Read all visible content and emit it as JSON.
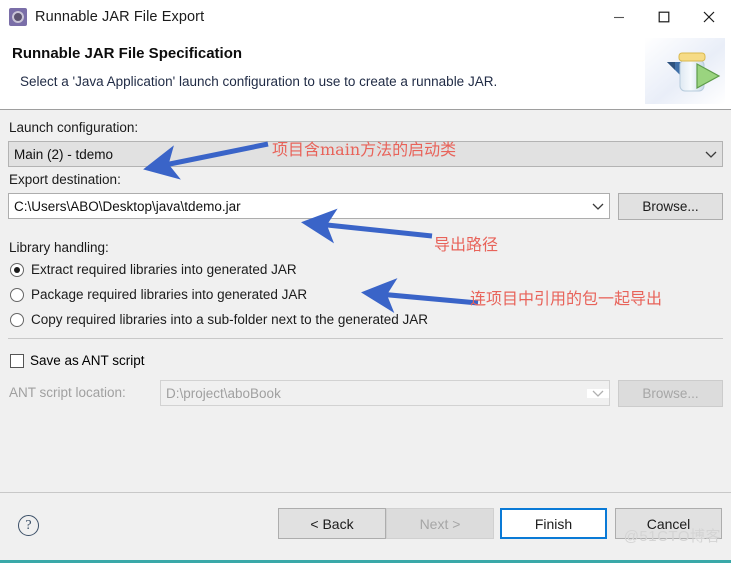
{
  "window": {
    "title": "Runnable JAR File Export",
    "title_icon": "jar-export-icon",
    "minimize_icon": "minimize-icon",
    "maximize_icon": "maximize-icon",
    "close_icon": "close-icon",
    "accent_border": "#3aa8a8"
  },
  "header": {
    "title": "Runnable JAR File Specification",
    "description": "Select a 'Java Application' launch configuration to use to create a runnable JAR.",
    "banner_icon": "jar-with-green-arrow-icon"
  },
  "form": {
    "launch_configuration": {
      "label": "Launch configuration:",
      "value": "Main (2) - tdemo",
      "dropdown_icon": "chevron-down-icon"
    },
    "export_destination": {
      "label": "Export destination:",
      "value": "C:\\Users\\ABO\\Desktop\\java\\tdemo.jar",
      "dropdown_icon": "chevron-down-icon",
      "browse_label": "Browse..."
    },
    "library_handling": {
      "label": "Library handling:",
      "options": [
        {
          "label": "Extract required libraries into generated JAR",
          "selected": true
        },
        {
          "label": "Package required libraries into generated JAR",
          "selected": false
        },
        {
          "label": "Copy required libraries into a sub-folder next to the generated JAR",
          "selected": false
        }
      ]
    },
    "ant": {
      "checkbox_label": "Save as ANT script",
      "checked": false,
      "location_label": "ANT script location:",
      "location_value": "D:\\project\\aboBook",
      "dropdown_icon": "chevron-down-icon",
      "browse_label": "Browse...",
      "disabled": true
    }
  },
  "footer": {
    "help_icon": "help-question-icon",
    "back_label": "< Back",
    "next_label": "Next >",
    "finish_label": "Finish",
    "cancel_label": "Cancel",
    "next_disabled": true,
    "primary_color": "#0a7ad6"
  },
  "annotations": {
    "color": "#e8635a",
    "arrow_color": "#3a64c8",
    "items": [
      {
        "text": "项目含main方法的启动类",
        "target": "launch-configuration-combo"
      },
      {
        "text": "导出路径",
        "target": "export-destination-textbox"
      },
      {
        "text": "连项目中引用的包一起导出",
        "target": "extract-libraries-radio"
      }
    ]
  },
  "watermark": {
    "text": "@51CTO博客"
  }
}
